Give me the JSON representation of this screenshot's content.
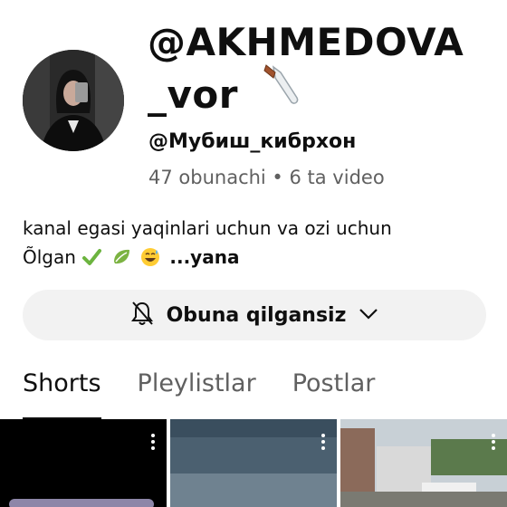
{
  "channel": {
    "title_line1": "@AKHMEDOVA",
    "title_line2": "_vor",
    "handle": "@Мубиш_кибрхон",
    "stats": "47 obunachi • 6 ta video",
    "avatar_icon": "profile-photo",
    "title_emoji": "knife-icon"
  },
  "description": {
    "line1": "kanal egasi yaqinlari uchun va ozi uchun",
    "line2_prefix": "Õlgan",
    "emojis": [
      "check-mark-icon",
      "leaf-icon",
      "grinning-sweat-icon"
    ],
    "more": "...yana"
  },
  "subscribe": {
    "label": "Obuna qilgansiz",
    "bell_icon": "bell-off-icon",
    "chevron_icon": "chevron-down-icon"
  },
  "tabs": [
    {
      "label": "Shorts",
      "active": true
    },
    {
      "label": "Pleylistlar",
      "active": false
    },
    {
      "label": "Postlar",
      "active": false
    }
  ],
  "thumbnails": [
    {
      "menu_icon": "more-vert-icon"
    },
    {
      "menu_icon": "more-vert-icon"
    },
    {
      "menu_icon": "more-vert-icon"
    }
  ],
  "colors": {
    "text_primary": "#0f0f0f",
    "text_secondary": "#606060",
    "button_bg": "#f2f2f2"
  }
}
